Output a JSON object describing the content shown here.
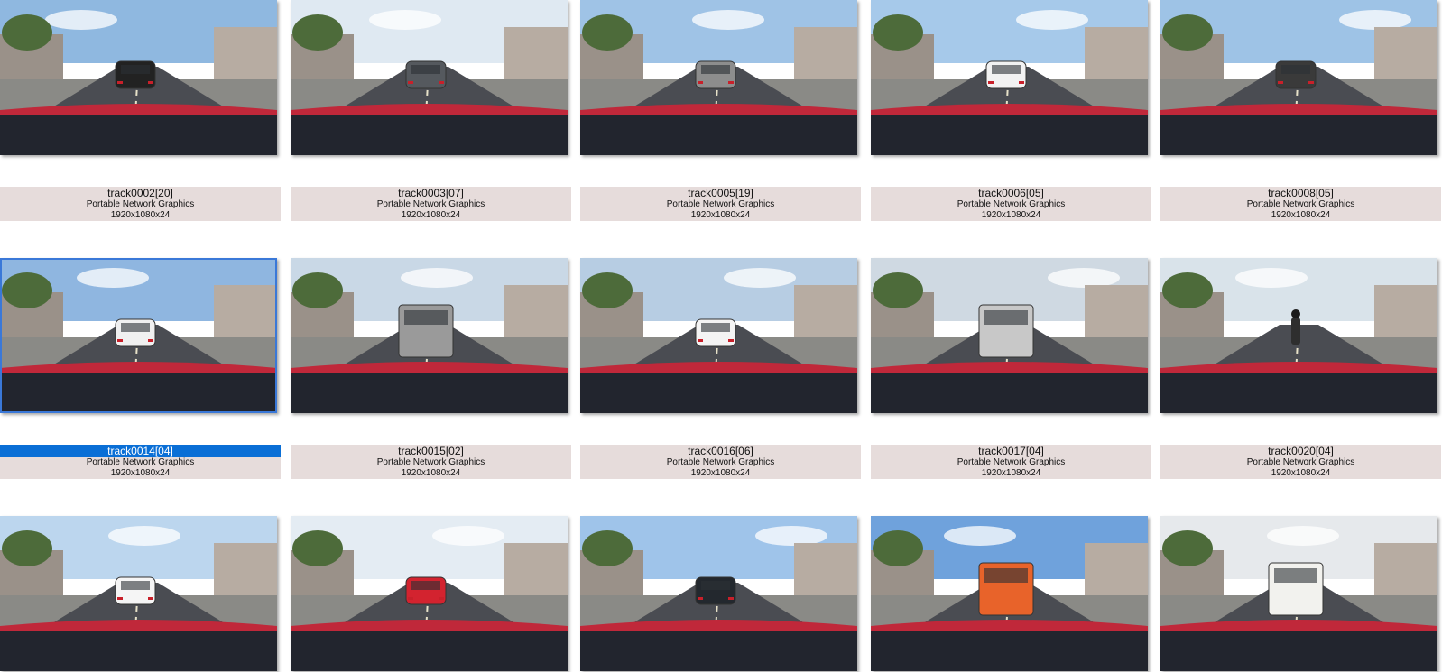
{
  "thumbnails": [
    {
      "name": "track0002[20]",
      "type": "Portable Network Graphics",
      "dims": "1920x1080x24",
      "sky": "#8fb8e0",
      "vehicle": "#222222",
      "vehicle_kind": "car",
      "selected": false
    },
    {
      "name": "track0003[07]",
      "type": "Portable Network Graphics",
      "dims": "1920x1080x24",
      "sky": "#dfe9f2",
      "vehicle": "#55595e",
      "vehicle_kind": "car",
      "selected": false
    },
    {
      "name": "track0005[19]",
      "type": "Portable Network Graphics",
      "dims": "1920x1080x24",
      "sky": "#9fc3e6",
      "vehicle": "#8d8d8d",
      "vehicle_kind": "car",
      "selected": false
    },
    {
      "name": "track0006[05]",
      "type": "Portable Network Graphics",
      "dims": "1920x1080x24",
      "sky": "#a6c9ea",
      "vehicle": "#f2f2f2",
      "vehicle_kind": "car",
      "selected": false
    },
    {
      "name": "track0008[05]",
      "type": "Portable Network Graphics",
      "dims": "1920x1080x24",
      "sky": "#9ec3e6",
      "vehicle": "#3a3a3a",
      "vehicle_kind": "car",
      "selected": false
    },
    {
      "name": "track0014[04]",
      "type": "Portable Network Graphics",
      "dims": "1920x1080x24",
      "sky": "#8fb6e0",
      "vehicle": "#f0f0f0",
      "vehicle_kind": "car",
      "selected": true
    },
    {
      "name": "track0015[02]",
      "type": "Portable Network Graphics",
      "dims": "1920x1080x24",
      "sky": "#c9d8e6",
      "vehicle": "#9a9a9a",
      "vehicle_kind": "truck",
      "selected": false
    },
    {
      "name": "track0016[06]",
      "type": "Portable Network Graphics",
      "dims": "1920x1080x24",
      "sky": "#b7cde3",
      "vehicle": "#f4f4f4",
      "vehicle_kind": "car",
      "selected": false
    },
    {
      "name": "track0017[04]",
      "type": "Portable Network Graphics",
      "dims": "1920x1080x24",
      "sky": "#cfd9e2",
      "vehicle": "#c8c8c8",
      "vehicle_kind": "van",
      "selected": false
    },
    {
      "name": "track0020[04]",
      "type": "Portable Network Graphics",
      "dims": "1920x1080x24",
      "sky": "#d9e3ea",
      "vehicle": "#2e2e2e",
      "vehicle_kind": "moto",
      "selected": false
    },
    {
      "name": "",
      "type": "",
      "dims": "",
      "sky": "#bcd6ee",
      "vehicle": "#f5f5f5",
      "vehicle_kind": "car",
      "selected": false
    },
    {
      "name": "",
      "type": "",
      "dims": "",
      "sky": "#e4ecf3",
      "vehicle": "#d3232f",
      "vehicle_kind": "car",
      "selected": false
    },
    {
      "name": "",
      "type": "",
      "dims": "",
      "sky": "#9fc4ea",
      "vehicle": "#23282e",
      "vehicle_kind": "car",
      "selected": false
    },
    {
      "name": "",
      "type": "",
      "dims": "",
      "sky": "#6fa2dc",
      "vehicle": "#e8632a",
      "vehicle_kind": "bus",
      "selected": false
    },
    {
      "name": "",
      "type": "",
      "dims": "",
      "sky": "#e6e9ec",
      "vehicle": "#f2f2ee",
      "vehicle_kind": "van",
      "selected": false
    }
  ],
  "colors": {
    "caption_bg": "#e6dcdb",
    "selection": "#0a6fd6",
    "hood": "#c0283a",
    "dash": "#22252e",
    "road": "#4a4c52"
  }
}
